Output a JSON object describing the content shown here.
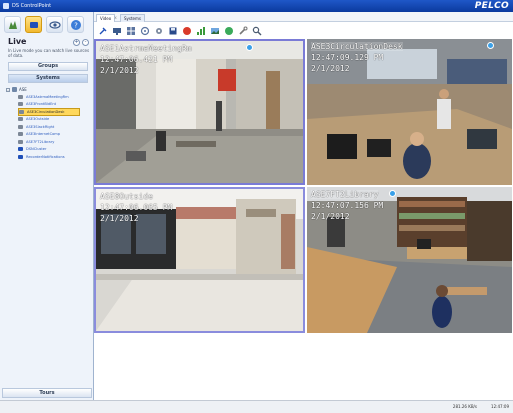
{
  "window": {
    "title": "DS ControlPoint",
    "brand": "PELCO"
  },
  "left_panel": {
    "nav_icons": [
      "sites-icon",
      "live-icon",
      "playback-icon",
      "help-icon"
    ],
    "title": "Live",
    "description": "In Live mode you can watch live sources of data.",
    "groups_label": "Groups",
    "systems_label": "Systems",
    "tree_root": "ASE",
    "tree_items": [
      {
        "label": "ASE3AstrmaMeetingRm",
        "icon": "camera-icon"
      },
      {
        "label": "ASE3FrontBldEnt",
        "icon": "camera-icon"
      },
      {
        "label": "ASE3CirculationDesk",
        "icon": "camera-icon",
        "selected": true
      },
      {
        "label": "ASE3Outside",
        "icon": "camera-icon"
      },
      {
        "label": "ASE3SlackRight",
        "icon": "camera-icon"
      },
      {
        "label": "ASE3InternetComp",
        "icon": "camera-icon"
      },
      {
        "label": "ASE7FT2Library",
        "icon": "camera-icon"
      },
      {
        "label": "DSNCluster",
        "icon": "folder-icon"
      },
      {
        "label": "RecorderNotifications",
        "icon": "folder-icon"
      }
    ],
    "tours_label": "Tours"
  },
  "tabs": {
    "video": "Video",
    "systems": "Systems"
  },
  "cameras": [
    {
      "name": "ASE1AstrmaMeetingRm",
      "time": "12:47:06.421 PM",
      "date": "2/1/2012"
    },
    {
      "name": "ASE3CirculationDesk",
      "time": "12:47:09.129 PM",
      "date": "2/1/2012"
    },
    {
      "name": "ASE8Outside",
      "time": "12:47:06.065 PM",
      "date": "2/1/2012"
    },
    {
      "name": "ASE7FT2Library",
      "time": "12:47:07.156 PM",
      "date": "2/1/2012"
    }
  ],
  "status": {
    "rate": "281.26 KB/s",
    "clock": "12:47:09"
  },
  "colors": {
    "titlebar": "#1f57c8",
    "accent": "#f2b92f",
    "selection": "#ffd85c"
  }
}
